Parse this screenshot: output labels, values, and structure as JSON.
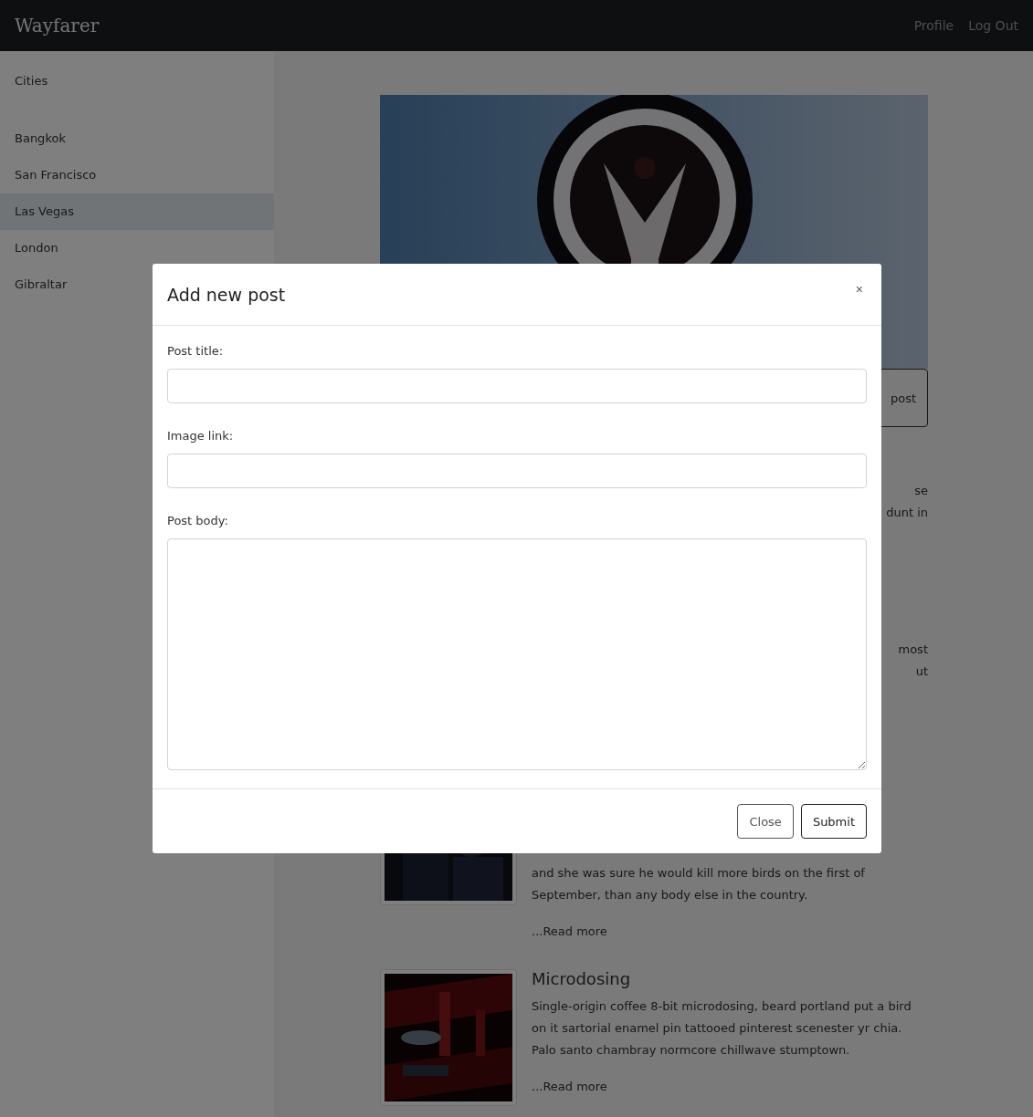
{
  "navbar": {
    "brand": "Wayfarer",
    "links": [
      "Profile",
      "Log Out"
    ]
  },
  "sidebar": {
    "heading": "Cities",
    "items": [
      {
        "label": "Bangkok",
        "selected": false
      },
      {
        "label": "San Francisco",
        "selected": false
      },
      {
        "label": "Las Vegas",
        "selected": true
      },
      {
        "label": "London",
        "selected": false
      },
      {
        "label": "Gibraltar",
        "selected": false
      }
    ]
  },
  "city": {
    "hero": {
      "kind": "picture"
    },
    "add_button": {
      "label": "post"
    },
    "fragments": [
      [
        "se",
        "dunt in"
      ],
      [
        "most",
        "ut"
      ]
    ]
  },
  "posts": [
    {
      "body": "and she was sure he would kill more birds on the first of September, than any body else in the country.",
      "read_more": "...Read more"
    },
    {
      "title": "Microdosing",
      "body": "Single-origin coffee 8-bit microdosing, beard portland put a bird on it sartorial enamel pin tattooed pinterest scenester yr chia. Palo santo chambray normcore chillwave stumptown.",
      "read_more": "...Read more"
    }
  ],
  "modal": {
    "title": "Add new post",
    "close": "×",
    "fields": [
      {
        "label": "Post title:",
        "kind": "input"
      },
      {
        "label": "Image link:",
        "kind": "input"
      },
      {
        "label": "Post body:",
        "kind": "textarea"
      }
    ],
    "buttons": [
      {
        "label": "Close",
        "kind": "secondary"
      },
      {
        "label": "Submit",
        "kind": "primary"
      }
    ]
  }
}
